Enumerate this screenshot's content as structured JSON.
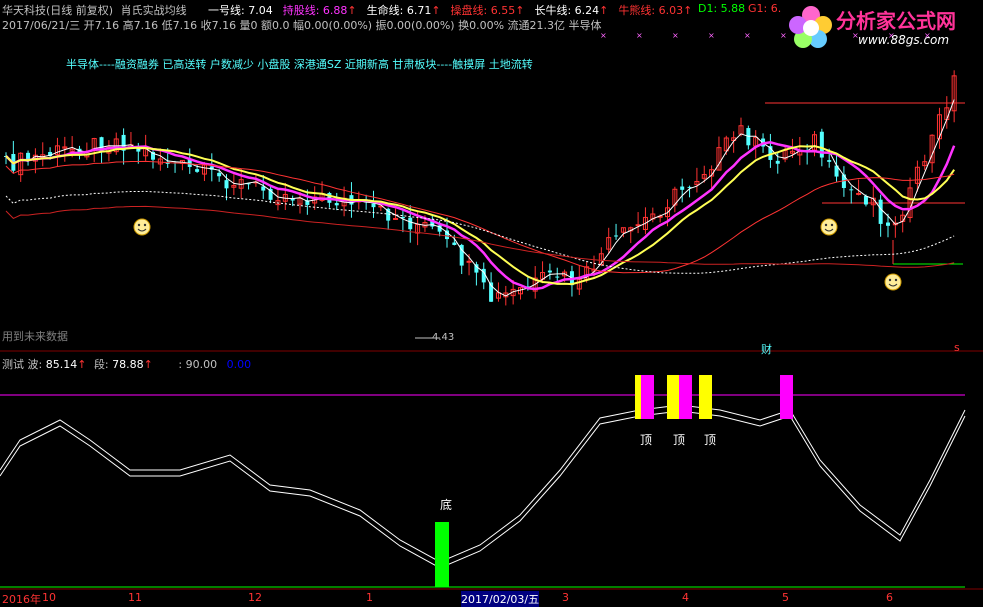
{
  "header": {
    "stock": "华天科技(日线 前复权)",
    "indicator": "肖氏实战均线",
    "ma": [
      {
        "label": "一号线:",
        "value": "7.04",
        "color": "#ffffff",
        "arrow": ""
      },
      {
        "label": "持股线:",
        "value": "6.88",
        "color": "#ff33ff",
        "arrow": "↑"
      },
      {
        "label": "生命线:",
        "value": "6.71",
        "color": "#ffffff",
        "arrow": "↑"
      },
      {
        "label": "操盘线:",
        "value": "6.55",
        "color": "#ff3333",
        "arrow": "↑"
      },
      {
        "label": "长牛线:",
        "value": "6.24",
        "color": "#ffffff",
        "arrow": "↑"
      },
      {
        "label": "牛熊线:",
        "value": "6.03",
        "color": "#ff3333",
        "arrow": "↑"
      }
    ],
    "d1": "D1: 5.88",
    "g1": "G1: 6."
  },
  "info_line": "2017/06/21/三 开7.16 高7.16 低7.16 收7.16 量0 额0.0 幅0.00(0.00%) 振0.00(0.00%) 换0.00% 流通21.3亿 半导体",
  "concepts": "半导体----融资融券 已高送转 户数减少 小盘股 深港通SZ 近期新高 甘肃板块----触摸屏 土地流转",
  "future_note": "用到未来数据",
  "low_label": "4.43",
  "cai_label": "财",
  "s_label": "s",
  "logo": {
    "title": "分析家公式网",
    "url": "www.88gs.com"
  },
  "sub_header": {
    "name": "测试",
    "wave_label": "波:",
    "wave_value": "85.14",
    "seg_label": "段:",
    "seg_value": "78.88",
    "level": ": 90.00",
    "zero": "0.00"
  },
  "signals": {
    "bottom": "底",
    "top": "顶"
  },
  "x_axis": [
    "2016年",
    "10",
    "11",
    "12",
    "1",
    "2017/02/03/五",
    "3",
    "4",
    "5",
    "6"
  ],
  "colors": {
    "up": "#ff3232",
    "down": "#54ffff",
    "ma1": "#ffffff",
    "hold": "#ff33ff",
    "life": "#ffff54",
    "grid": "#800000",
    "pink": "#ff00ff",
    "yellow": "#ffff00",
    "green": "#00ff00"
  }
}
